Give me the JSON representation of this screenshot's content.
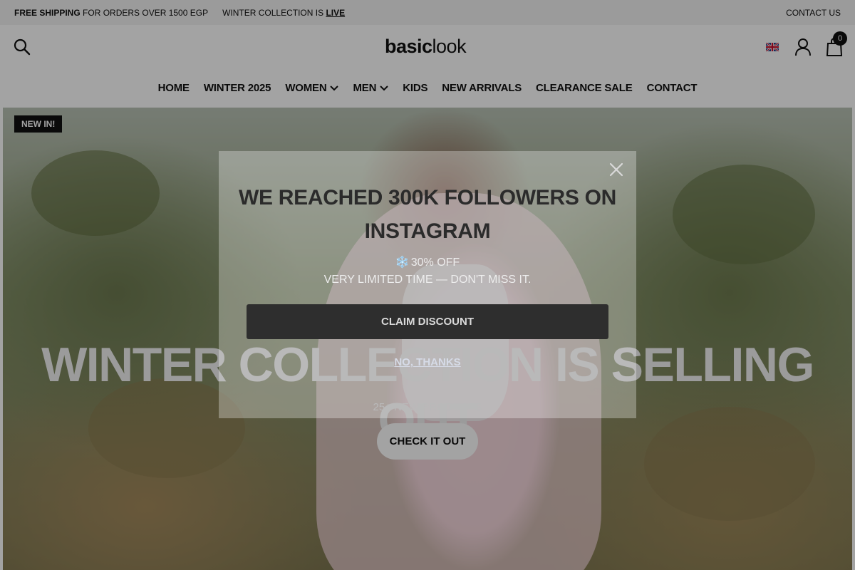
{
  "announcement": {
    "shipping_bold": "FREE SHIPPING",
    "shipping_text": "FOR ORDERS OVER 1500 EGP",
    "winter_text": "WINTER COLLECTION IS",
    "winter_live": "LIVE",
    "contact": "CONTACT US"
  },
  "header": {
    "logo_bold": "basic",
    "logo_light": "look",
    "cart_count": "0",
    "language_icon": "uk-flag-icon",
    "icons": [
      "search-icon",
      "user-icon",
      "shopping-bag-icon"
    ]
  },
  "nav": {
    "items": [
      {
        "label": "HOME"
      },
      {
        "label": "WINTER 2025"
      },
      {
        "label": "WOMEN"
      },
      {
        "label": "MEN"
      },
      {
        "label": "KIDS"
      },
      {
        "label": "NEW ARRIVALS"
      },
      {
        "label": "CLEARANCE SALE"
      },
      {
        "label": "CONTACT"
      }
    ]
  },
  "hero": {
    "badge": "NEW IN!",
    "title": "WINTER COLLECTION IS SELLING OUT",
    "subtitle": "25+ NEW PRODUCTS",
    "button": "CHECK IT OUT"
  },
  "popup": {
    "title_line1": "WE REACHED 300K FOLLOWERS ON",
    "title_line2": "INSTAGRAM",
    "discount_icon": "❄️",
    "discount": "30% OFF",
    "description": "VERY LIMITED TIME — DON'T MISS IT.",
    "claim_button": "CLAIM DISCOUNT",
    "dismiss": "NO, THANKS"
  },
  "colors": {
    "overlay": "#000000",
    "text_dark": "#111111",
    "badge_bg": "#111111"
  }
}
